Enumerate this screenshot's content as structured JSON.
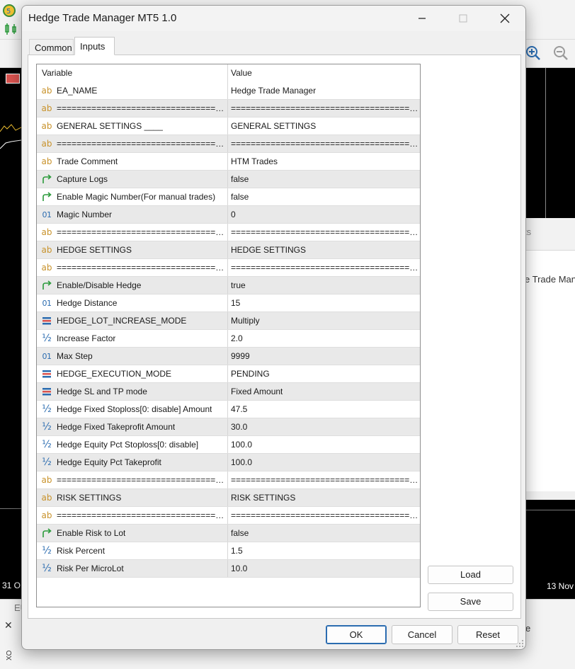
{
  "window": {
    "title": "Hedge Trade Manager MT5 1.0"
  },
  "tabs": [
    {
      "label": "Common"
    },
    {
      "label": "Inputs"
    }
  ],
  "grid": {
    "headers": {
      "variable": "Variable",
      "value": "Value"
    },
    "rows": [
      {
        "icon": "string-icon",
        "variable": "EA_NAME",
        "value": "Hedge Trade Manager"
      },
      {
        "icon": "string-icon",
        "variable": "===========================================",
        "value": "==========================================="
      },
      {
        "icon": "string-icon",
        "variable": "GENERAL SETTINGS ____",
        "value": "GENERAL SETTINGS"
      },
      {
        "icon": "string-icon",
        "variable": "===========================================",
        "value": "==========================================="
      },
      {
        "icon": "string-icon",
        "variable": "Trade Comment",
        "value": "HTM Trades"
      },
      {
        "icon": "bool-icon",
        "variable": "Capture Logs",
        "value": "false"
      },
      {
        "icon": "bool-icon",
        "variable": "Enable Magic Number(For manual trades)",
        "value": "false"
      },
      {
        "icon": "int-icon",
        "variable": "Magic Number",
        "value": "0"
      },
      {
        "icon": "string-icon",
        "variable": "===========================================",
        "value": "==========================================="
      },
      {
        "icon": "string-icon",
        "variable": "HEDGE SETTINGS",
        "value": "HEDGE SETTINGS"
      },
      {
        "icon": "string-icon",
        "variable": "===========================================",
        "value": "==========================================="
      },
      {
        "icon": "bool-icon",
        "variable": "Enable/Disable Hedge",
        "value": "true"
      },
      {
        "icon": "int-icon",
        "variable": "Hedge Distance",
        "value": "15"
      },
      {
        "icon": "enum-icon",
        "variable": "HEDGE_LOT_INCREASE_MODE",
        "value": "Multiply"
      },
      {
        "icon": "double-icon",
        "variable": "Increase Factor",
        "value": "2.0"
      },
      {
        "icon": "int-icon",
        "variable": "Max Step",
        "value": "9999"
      },
      {
        "icon": "enum-icon",
        "variable": "HEDGE_EXECUTION_MODE",
        "value": "PENDING"
      },
      {
        "icon": "enum-icon",
        "variable": "Hedge SL and TP mode",
        "value": "Fixed Amount"
      },
      {
        "icon": "double-icon",
        "variable": "Hedge Fixed Stoploss[0: disable] Amount",
        "value": "47.5"
      },
      {
        "icon": "double-icon",
        "variable": "Hedge Fixed Takeprofit Amount",
        "value": "30.0"
      },
      {
        "icon": "double-icon",
        "variable": "Hedge Equity Pct Stoploss[0: disable]",
        "value": "100.0"
      },
      {
        "icon": "double-icon",
        "variable": "Hedge Equity Pct Takeprofit",
        "value": "100.0"
      },
      {
        "icon": "string-icon",
        "variable": "===========================================",
        "value": "==========================================="
      },
      {
        "icon": "string-icon",
        "variable": "RISK SETTINGS",
        "value": "RISK SETTINGS"
      },
      {
        "icon": "string-icon",
        "variable": "===========================================",
        "value": "==========================================="
      },
      {
        "icon": "bool-icon",
        "variable": "Enable Risk to Lot",
        "value": "false"
      },
      {
        "icon": "double-icon",
        "variable": "Risk Percent",
        "value": "1.5"
      },
      {
        "icon": "double-icon",
        "variable": "Risk Per MicroLot",
        "value": "10.0"
      }
    ]
  },
  "side_buttons": {
    "load": "Load",
    "save": "Save"
  },
  "footer_buttons": {
    "ok": "OK",
    "cancel": "Cancel",
    "reset": "Reset"
  },
  "background": {
    "axis_left": "31 O",
    "axis_right": "13 Nov",
    "panel_partial_text": "ts",
    "panel_partial_item": "e Trade Man",
    "tab_eu": "EU",
    "tab_partial_e": "e"
  },
  "colors": {
    "accent": "#2b6cb0",
    "string_icon": "#c8922a",
    "bool_icon": "#2a9a3a",
    "alt_row": "#e9e9e9"
  }
}
